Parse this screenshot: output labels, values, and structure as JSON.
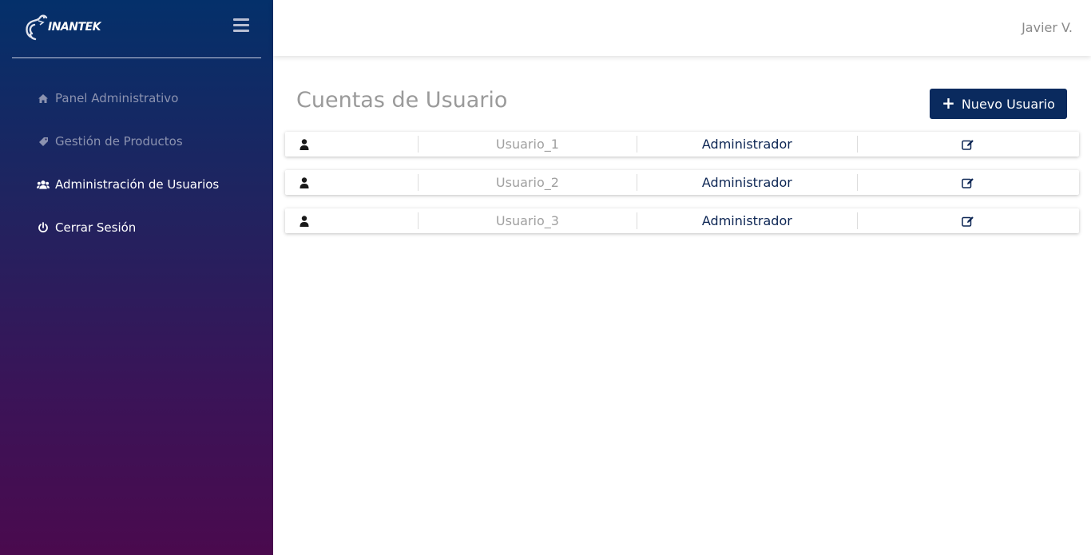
{
  "brand": {
    "name": "INANTEK"
  },
  "sidebar": {
    "items": [
      {
        "label": "Panel Administrativo",
        "icon": "home-icon"
      },
      {
        "label": "Gestión de Productos",
        "icon": "tag-icon"
      },
      {
        "label": "Administración de Usuarios",
        "icon": "users-icon"
      },
      {
        "label": "Cerrar Sesión",
        "icon": "power-icon"
      }
    ]
  },
  "header": {
    "user": "Javier V."
  },
  "main": {
    "title": "Cuentas de Usuario",
    "new_button": "Nuevo Usuario"
  },
  "users": [
    {
      "name": "Usuario_1",
      "role": "Administrador"
    },
    {
      "name": "Usuario_2",
      "role": "Administrador"
    },
    {
      "name": "Usuario_3",
      "role": "Administrador"
    }
  ],
  "colors": {
    "sidebar_top": "#04306a",
    "sidebar_bottom": "#4a0a4e",
    "button": "#0a2a5e",
    "role_text": "#0d2654"
  }
}
